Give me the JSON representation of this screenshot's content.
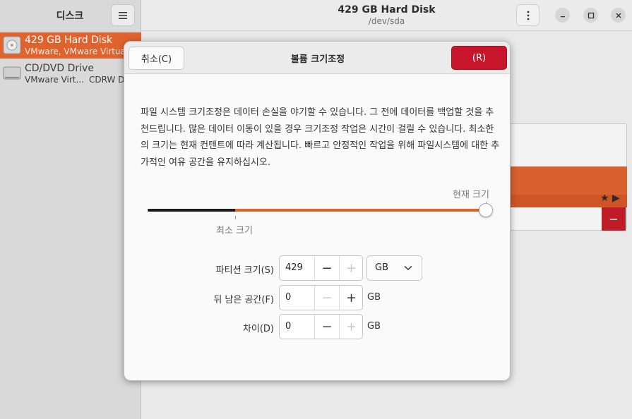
{
  "sidebar": {
    "title": "디스크",
    "disks": [
      {
        "name": "429 GB Hard Disk",
        "sub": "VMware, VMware Virtual S"
      },
      {
        "name": "CD/DVD Drive",
        "sub": "VMware Virt...",
        "sub2": "CDRW Dri"
      }
    ]
  },
  "header": {
    "title": "429 GB Hard Disk",
    "subtitle": "/dev/sda"
  },
  "dialog": {
    "cancel_label": "취소(C)",
    "title": "볼륨 크기조정",
    "resize_label": "(R)",
    "description": "파일 시스템 크기조정은 데이터 손실을 야기할 수 있습니다. 그 전에 데이터를 백업할 것을 추천드립니다. 많은 데이터 이동이 있을 경우 크기조정 작업은 시간이 걸릴 수 있습니다. 최소한의 크기는 현재 컨텐트에 따라 계산됩니다. 빠르고 안정적인 작업을 위해 파일시스템에 대한 추가적인 여유 공간을 유지하십시오.",
    "slider": {
      "current_label": "현재 크기",
      "min_label": "최소 크기",
      "minimum_fraction": 0.25,
      "value_fraction": 1.0
    },
    "fields": {
      "partition_size": {
        "label": "파티션 크기(S)",
        "value": "429",
        "unit": "GB"
      },
      "free_following": {
        "label": "뒤 남은 공간(F)",
        "value": "0",
        "unit": "GB"
      },
      "difference": {
        "label": "차이(D)",
        "value": "0",
        "unit": "GB"
      }
    }
  },
  "colors": {
    "accent": "#e0632e",
    "destructive": "#c7162b"
  }
}
